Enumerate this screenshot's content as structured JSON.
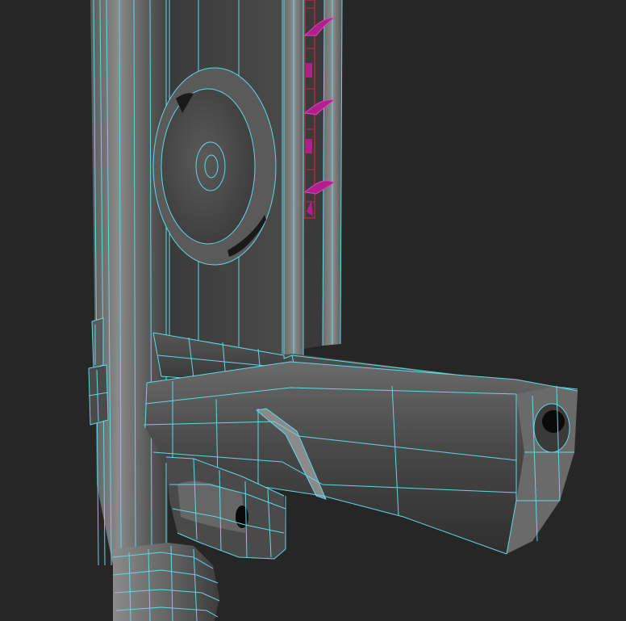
{
  "viewport": {
    "background": "#262626",
    "wire_color": "#5fd8e6",
    "highlight_wire_color": "#c8283c",
    "highlight_fill_color": "#b0208c",
    "shade_light": "#7a7a7a",
    "shade_mid": "#4e4e4e",
    "shade_dark": "#2e2e2e"
  },
  "model": {
    "parts": [
      "pillar",
      "disc",
      "slide",
      "barrel-frame",
      "grip",
      "trigger-guard",
      "side-lugs",
      "trim-hooks"
    ]
  }
}
